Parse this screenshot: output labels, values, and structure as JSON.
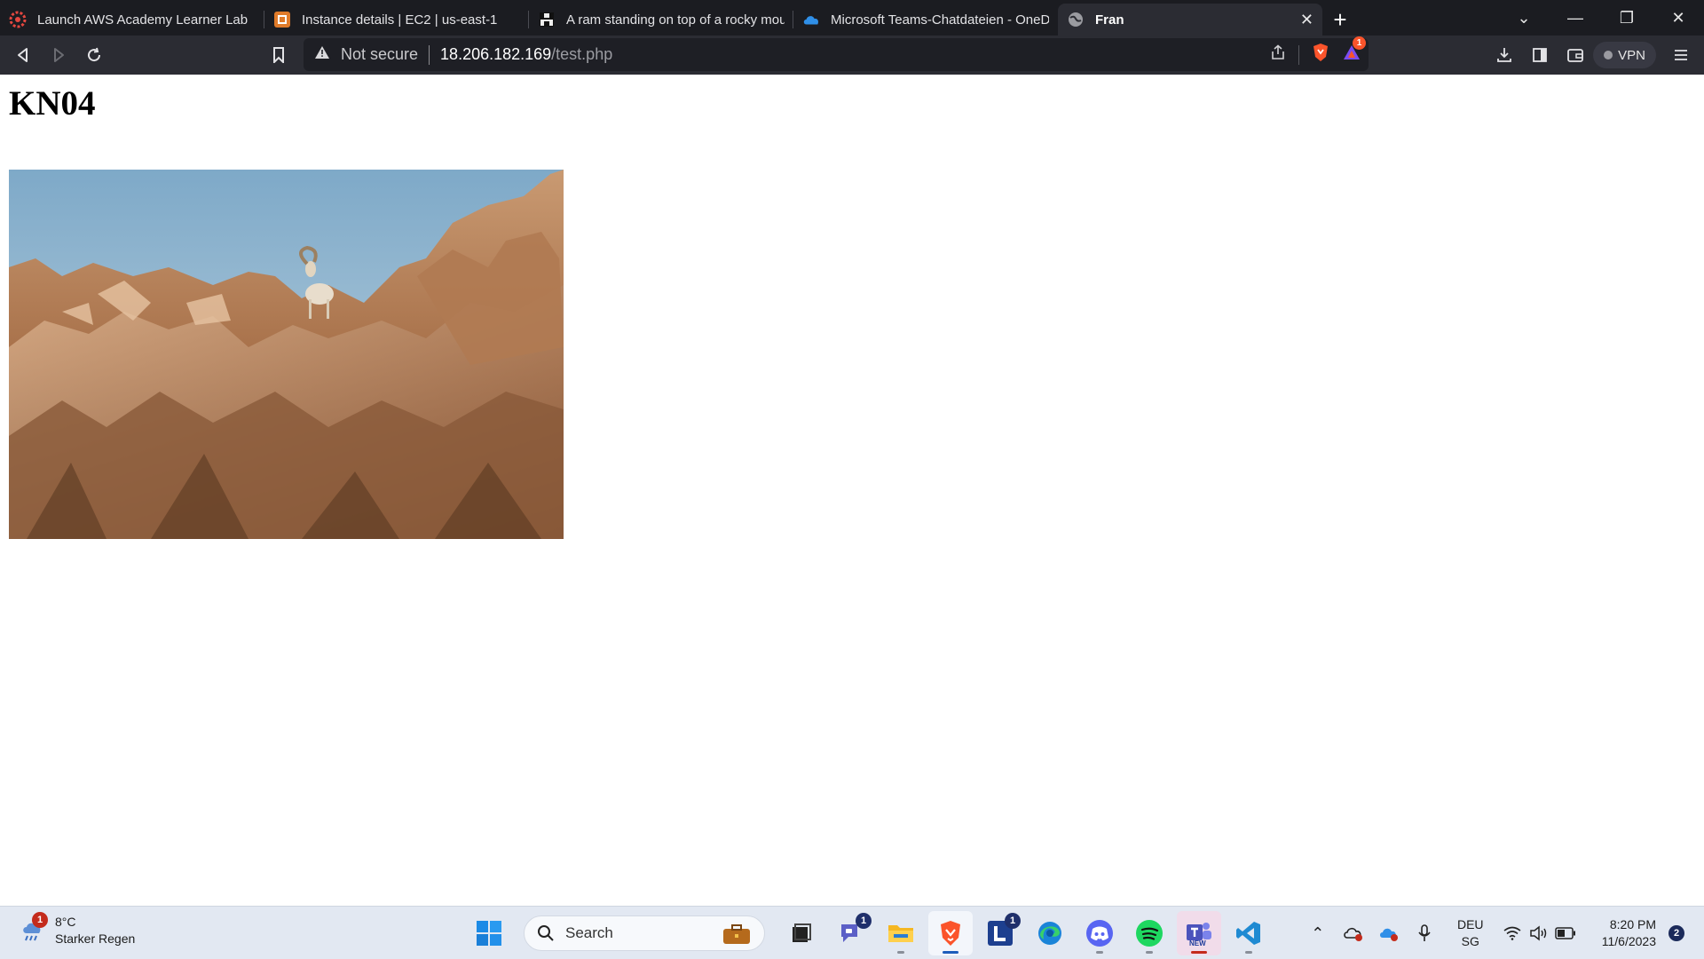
{
  "browser": {
    "tabs": [
      {
        "title": "Launch AWS Academy Learner Lab",
        "icon": "aws-academy-icon"
      },
      {
        "title": "Instance details | EC2 | us-east-1",
        "icon": "aws-ec2-icon"
      },
      {
        "title": "A ram standing on top of a rocky mou",
        "icon": "unsplash-icon"
      },
      {
        "title": "Microsoft Teams-Chatdateien - OneDr",
        "icon": "onedrive-icon"
      },
      {
        "title": "Fran",
        "icon": "globe-icon",
        "active": true
      }
    ],
    "address": {
      "security_label": "Not secure",
      "host": "18.206.182.169",
      "path": "/test.php"
    },
    "shields_badge": "1",
    "vpn_label": "VPN"
  },
  "page": {
    "heading": "KN04",
    "image_subject": "A ram standing on top of a rocky mountain"
  },
  "taskbar": {
    "weather": {
      "badge": "1",
      "temp": "8°C",
      "condition": "Starker Regen"
    },
    "search_label": "Search",
    "teams_badge": "1",
    "app_l_badge": "1",
    "teams_new_label": "NEW",
    "language": {
      "line1": "DEU",
      "line2": "SG"
    },
    "clock": {
      "time": "8:20 PM",
      "date": "11/6/2023"
    },
    "notifications": "2"
  },
  "colors": {
    "tabstrip": "#1b1c21",
    "toolbar": "#2b2c33",
    "brave_orange": "#fb542b",
    "taskbar": "#e2e8f2"
  }
}
